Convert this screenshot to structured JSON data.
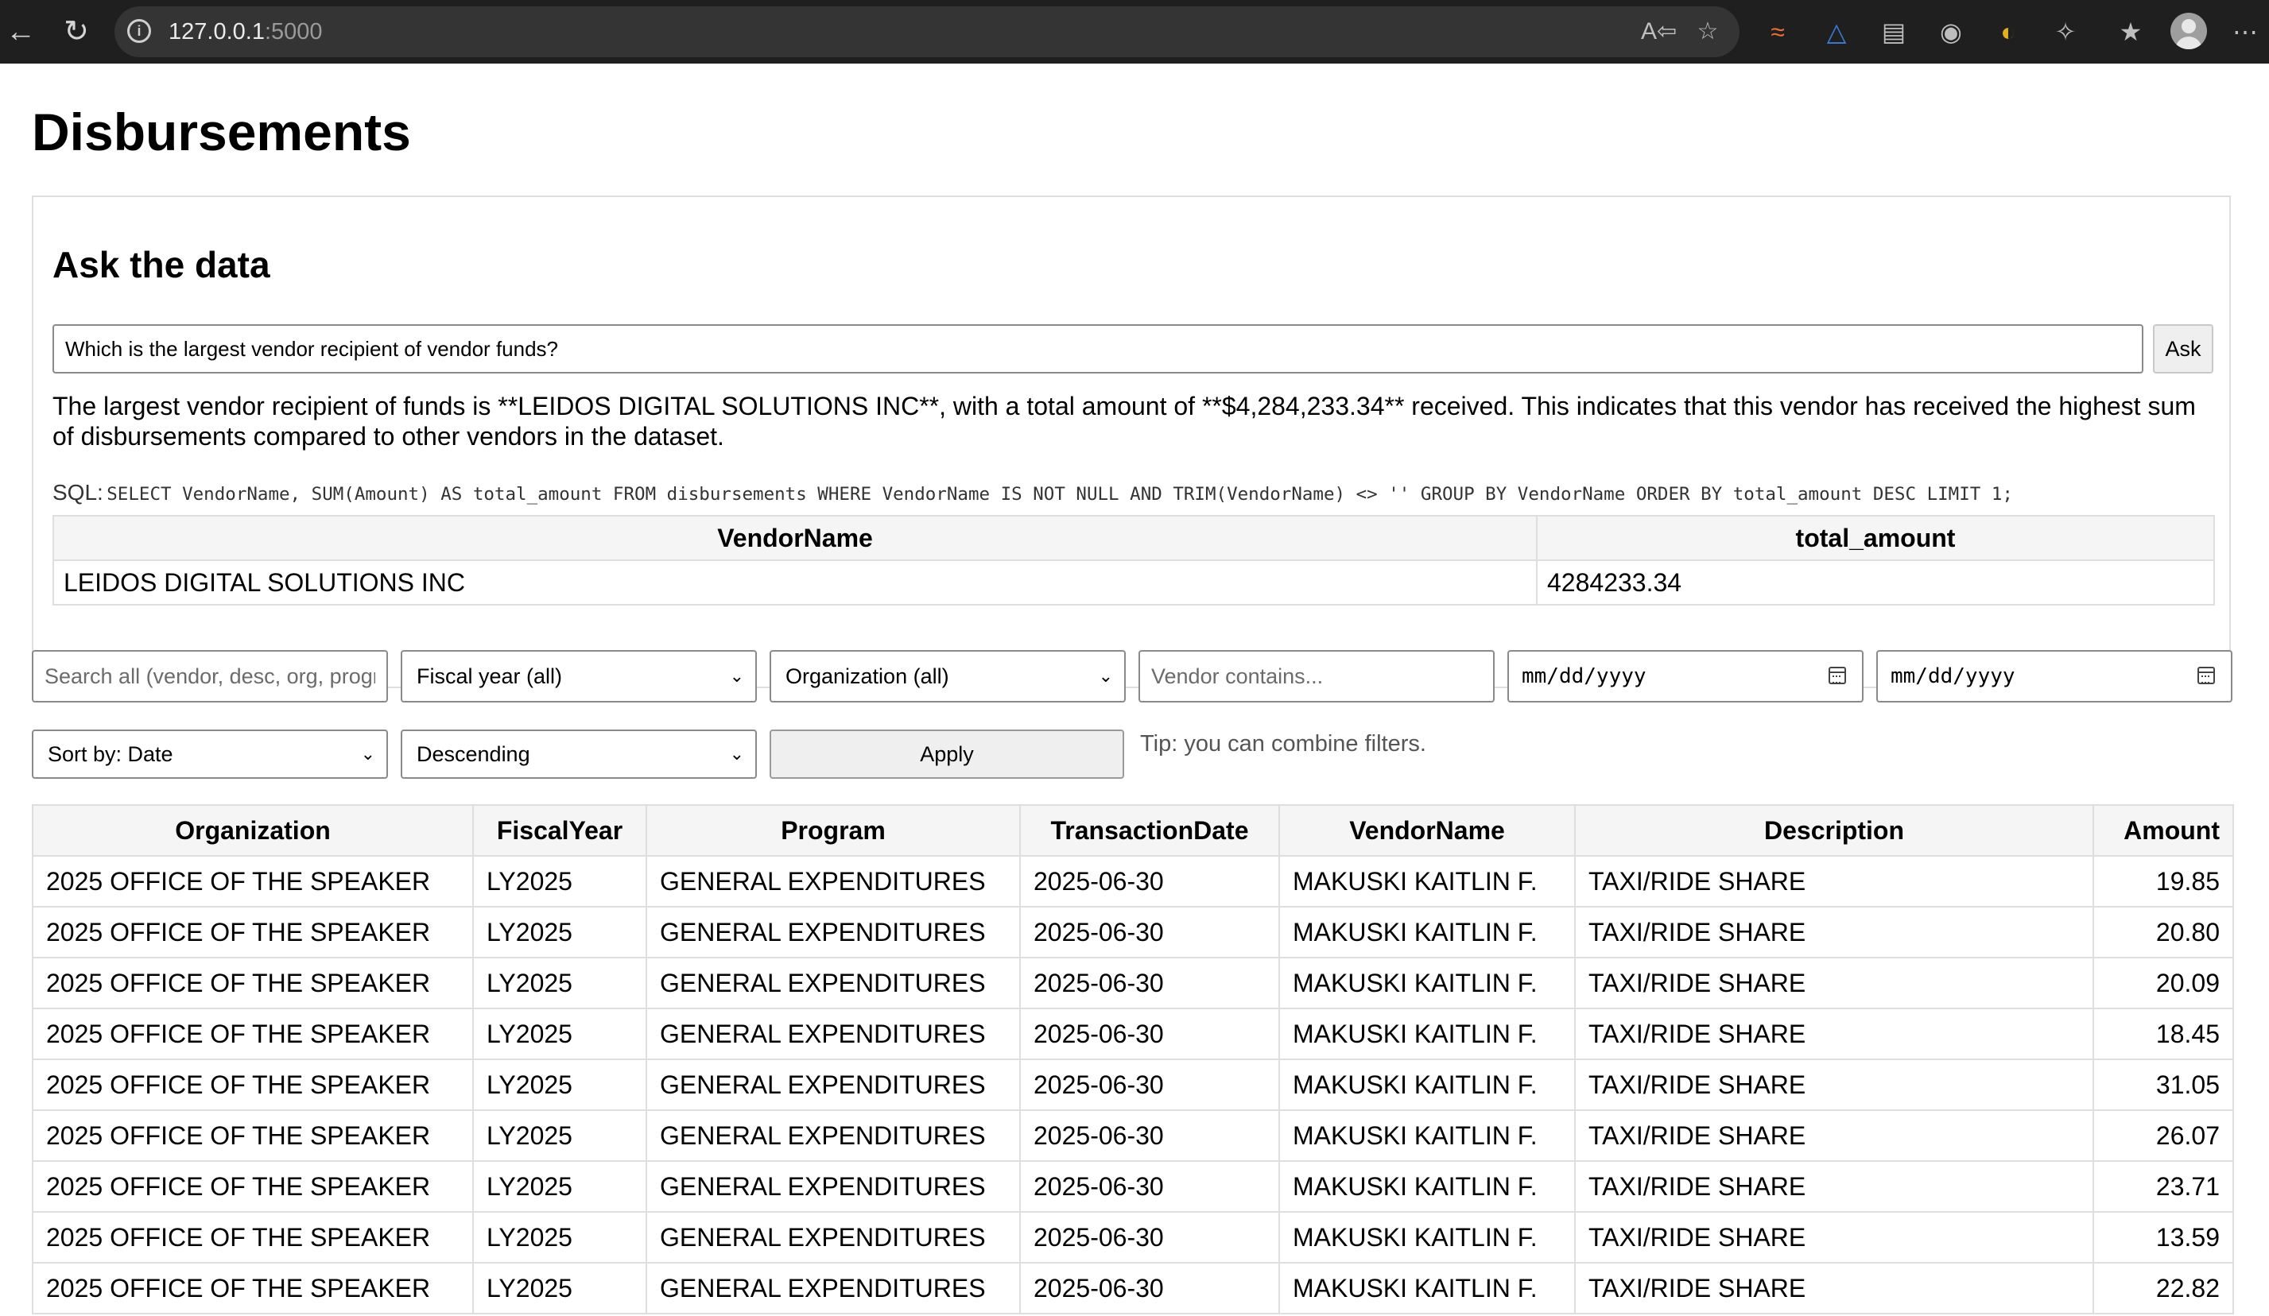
{
  "browser": {
    "url_host": "127.0.0.1",
    "url_port": ":5000",
    "extensions": [
      "rainbow-extension-icon",
      "triangle-extension-icon",
      "screenshot-extension-icon",
      "link-extension-icon",
      "color-picker-extension-icon",
      "puzzle-icon",
      "favorites-icon"
    ]
  },
  "page_title": "Disbursements",
  "ask": {
    "heading": "Ask the data",
    "question": "Which is the largest vendor recipient of vendor funds?",
    "button_label": "Ask",
    "answer": "The largest vendor recipient of funds is **LEIDOS DIGITAL SOLUTIONS INC**, with a total amount of **$4,284,233.34** received. This indicates that this vendor has received the highest sum of disbursements compared to other vendors in the dataset.",
    "sql_label": "SQL:",
    "sql": "SELECT VendorName, SUM(Amount) AS total_amount FROM disbursements WHERE VendorName IS NOT NULL AND TRIM(VendorName) <> '' GROUP BY VendorName ORDER BY total_amount DESC LIMIT 1;",
    "result": {
      "headers": [
        "VendorName",
        "total_amount"
      ],
      "rows": [
        [
          "LEIDOS DIGITAL SOLUTIONS INC",
          "4284233.34"
        ]
      ]
    }
  },
  "filters": {
    "search_placeholder": "Search all (vendor, desc, org, progr",
    "fiscal_year": "Fiscal year (all)",
    "organization": "Organization (all)",
    "vendor_placeholder": "Vendor contains...",
    "date_from": "mm/dd/yyyy",
    "date_to": "mm/dd/yyyy",
    "sort_by": "Sort by: Date",
    "order": "Descending",
    "apply_label": "Apply",
    "tip": "Tip: you can combine filters."
  },
  "table": {
    "headers": [
      "Organization",
      "FiscalYear",
      "Program",
      "TransactionDate",
      "VendorName",
      "Description",
      "Amount"
    ],
    "rows": [
      [
        "2025 OFFICE OF THE SPEAKER",
        "LY2025",
        "GENERAL EXPENDITURES",
        "2025-06-30",
        "MAKUSKI KAITLIN F.",
        "TAXI/RIDE SHARE",
        "19.85"
      ],
      [
        "2025 OFFICE OF THE SPEAKER",
        "LY2025",
        "GENERAL EXPENDITURES",
        "2025-06-30",
        "MAKUSKI KAITLIN F.",
        "TAXI/RIDE SHARE",
        "20.80"
      ],
      [
        "2025 OFFICE OF THE SPEAKER",
        "LY2025",
        "GENERAL EXPENDITURES",
        "2025-06-30",
        "MAKUSKI KAITLIN F.",
        "TAXI/RIDE SHARE",
        "20.09"
      ],
      [
        "2025 OFFICE OF THE SPEAKER",
        "LY2025",
        "GENERAL EXPENDITURES",
        "2025-06-30",
        "MAKUSKI KAITLIN F.",
        "TAXI/RIDE SHARE",
        "18.45"
      ],
      [
        "2025 OFFICE OF THE SPEAKER",
        "LY2025",
        "GENERAL EXPENDITURES",
        "2025-06-30",
        "MAKUSKI KAITLIN F.",
        "TAXI/RIDE SHARE",
        "31.05"
      ],
      [
        "2025 OFFICE OF THE SPEAKER",
        "LY2025",
        "GENERAL EXPENDITURES",
        "2025-06-30",
        "MAKUSKI KAITLIN F.",
        "TAXI/RIDE SHARE",
        "26.07"
      ],
      [
        "2025 OFFICE OF THE SPEAKER",
        "LY2025",
        "GENERAL EXPENDITURES",
        "2025-06-30",
        "MAKUSKI KAITLIN F.",
        "TAXI/RIDE SHARE",
        "23.71"
      ],
      [
        "2025 OFFICE OF THE SPEAKER",
        "LY2025",
        "GENERAL EXPENDITURES",
        "2025-06-30",
        "MAKUSKI KAITLIN F.",
        "TAXI/RIDE SHARE",
        "13.59"
      ],
      [
        "2025 OFFICE OF THE SPEAKER",
        "LY2025",
        "GENERAL EXPENDITURES",
        "2025-06-30",
        "MAKUSKI KAITLIN F.",
        "TAXI/RIDE SHARE",
        "22.82"
      ]
    ]
  }
}
